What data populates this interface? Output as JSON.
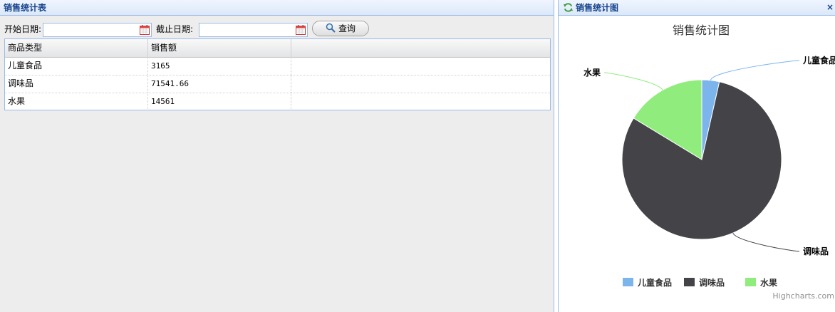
{
  "left_panel": {
    "title": "销售统计表",
    "toolbar": {
      "start_label": "开始日期:",
      "end_label": "截止日期:",
      "start_value": "",
      "end_value": "",
      "query_label": "查询"
    },
    "grid": {
      "columns": [
        "商品类型",
        "销售额"
      ],
      "rows": [
        [
          "儿童食品",
          "3165"
        ],
        [
          "调味品",
          "71541.66"
        ],
        [
          "水果",
          "14561"
        ]
      ]
    }
  },
  "right_panel": {
    "title": "销售统计图",
    "credits": "Highcharts.com"
  },
  "chart_data": {
    "type": "pie",
    "title": "销售统计图",
    "legend_position": "bottom",
    "categories": [
      "儿童食品",
      "调味品",
      "水果"
    ],
    "values": [
      3165,
      71541.66,
      14561
    ],
    "colors": [
      "#7cb5ec",
      "#434348",
      "#90ed7d"
    ]
  }
}
